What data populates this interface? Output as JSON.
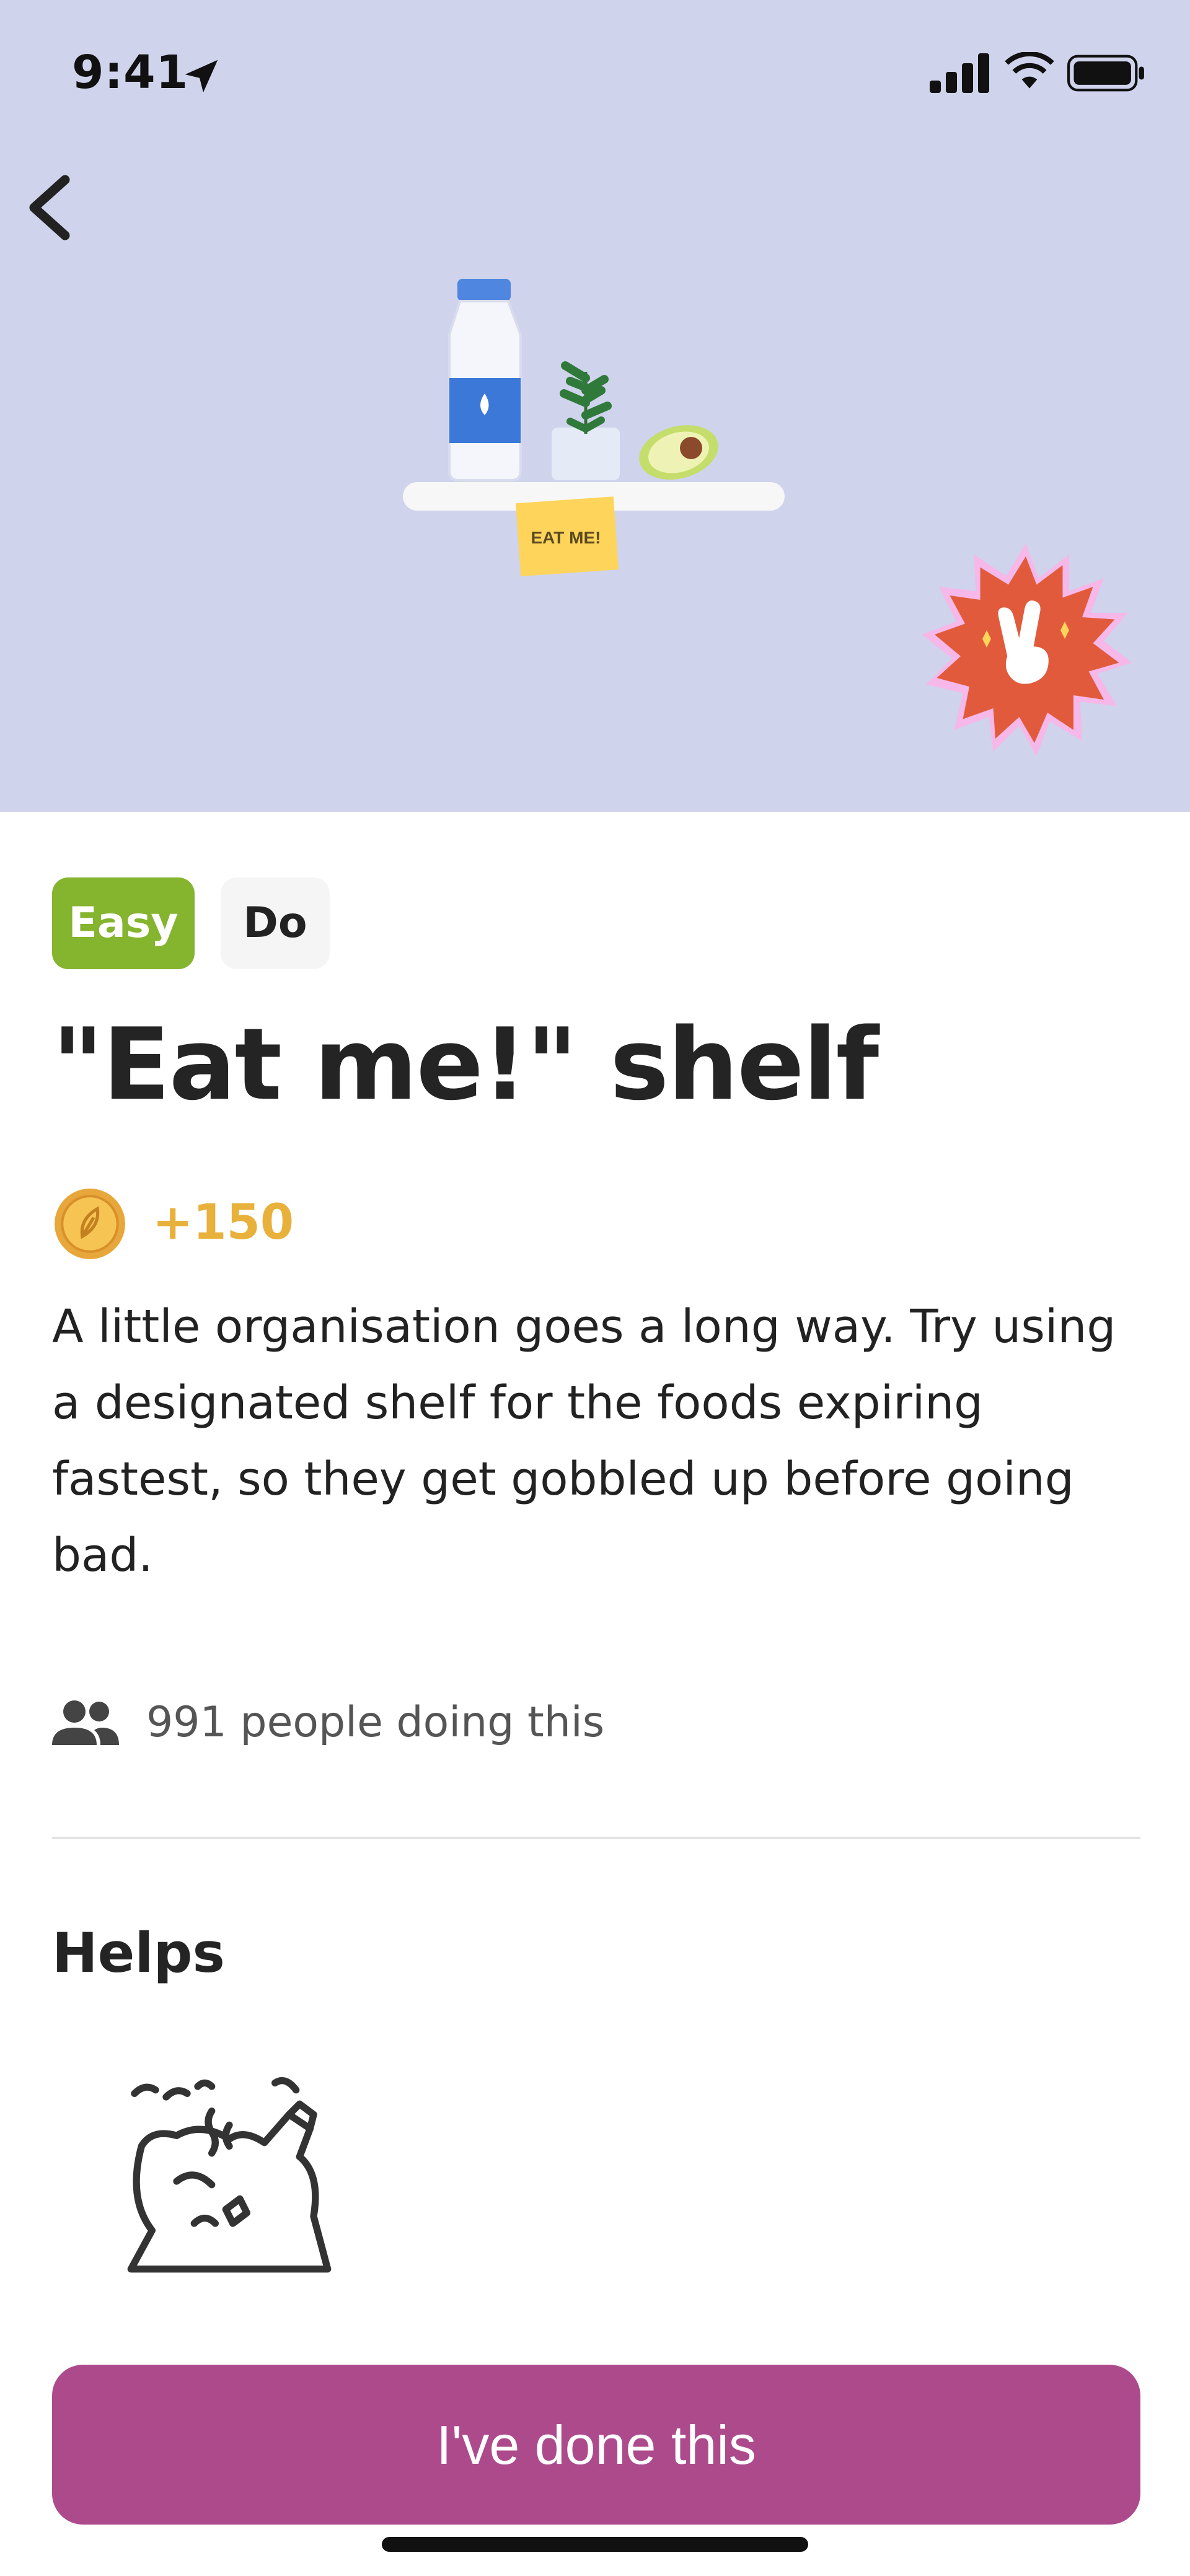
{
  "status_bar": {
    "time": "9:41"
  },
  "hero": {
    "illustration_label": "EAT ME!",
    "background_color": "#cfd3ec",
    "badge_color": "#e25a3c"
  },
  "tags": [
    {
      "label": "Easy",
      "color": "#85b42f"
    },
    {
      "label": "Do",
      "color": "#f5f5f5"
    }
  ],
  "title": "\"Eat me!\" shelf",
  "points": "+150",
  "description": "A little organisation goes a long way. Try using a designated shelf for the foods expiring fastest, so they get gobbled up before going bad.",
  "people": "991 people doing this",
  "helps": {
    "heading": "Helps",
    "items": [
      {
        "icon": "food-waste-icon"
      }
    ]
  },
  "cta": {
    "label": "I've done this",
    "color": "#ad4a8c"
  },
  "icons": [
    "location-arrow-icon",
    "cellular-signal-icon",
    "wifi-icon",
    "battery-icon",
    "back-chevron-icon",
    "coin-icon",
    "people-icon",
    "food-waste-icon",
    "peace-hand-icon"
  ]
}
